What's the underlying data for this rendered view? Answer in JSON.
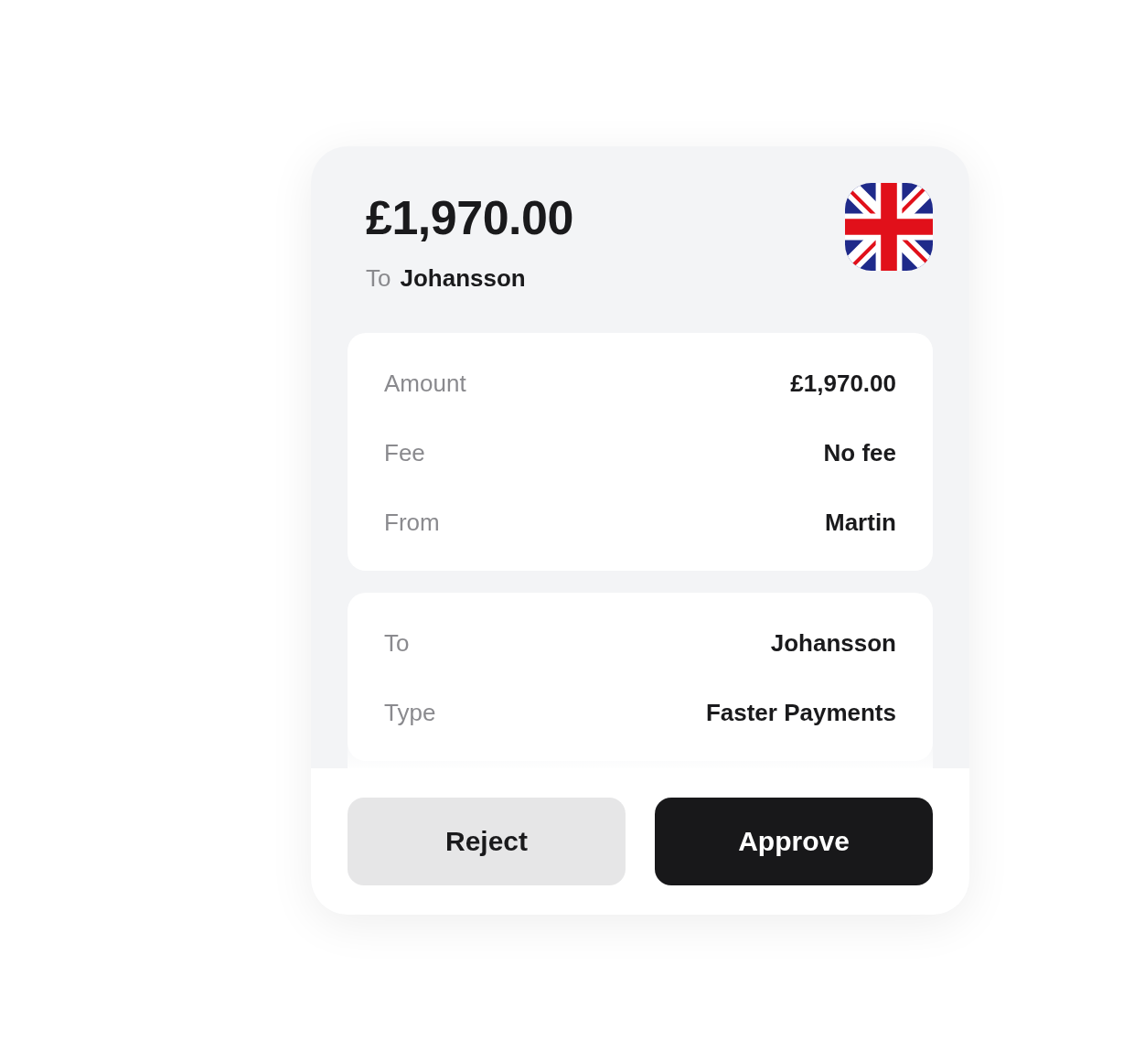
{
  "header": {
    "amount": "£1,970.00",
    "to_label": "To",
    "to_name": "Johansson"
  },
  "sections": [
    {
      "rows": [
        {
          "label": "Amount",
          "value": "£1,970.00"
        },
        {
          "label": "Fee",
          "value": "No fee"
        },
        {
          "label": "From",
          "value": "Martin"
        }
      ]
    },
    {
      "rows": [
        {
          "label": "To",
          "value": "Johansson"
        },
        {
          "label": "Type",
          "value": "Faster Payments"
        }
      ]
    }
  ],
  "actions": [
    {
      "kind": "secondary",
      "label": "Reject"
    },
    {
      "kind": "primary",
      "label": "Approve"
    }
  ]
}
